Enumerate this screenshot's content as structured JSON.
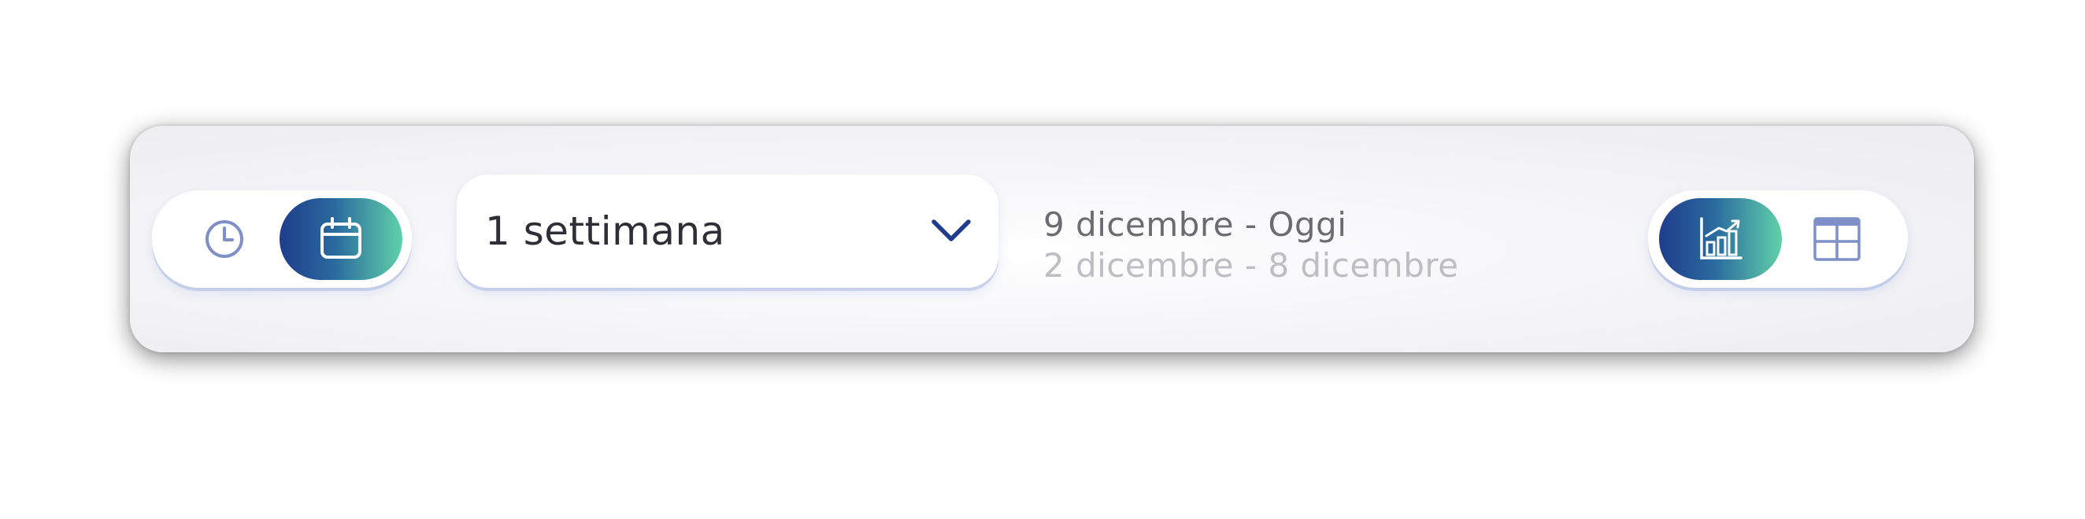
{
  "view_toggle": {
    "options": [
      {
        "icon": "clock-icon",
        "active": false
      },
      {
        "icon": "calendar-icon",
        "active": true
      }
    ]
  },
  "period_select": {
    "value": "1 settimana",
    "icon": "chevron-down-icon"
  },
  "date_range": {
    "current": "9 dicembre - Oggi",
    "previous": "2 dicembre - 8 dicembre"
  },
  "display_toggle": {
    "options": [
      {
        "icon": "chart-icon",
        "active": true
      },
      {
        "icon": "table-icon",
        "active": false
      }
    ]
  },
  "colors": {
    "accent_start": "#1f3d8c",
    "accent_end": "#5fd1a8",
    "icon_muted": "#7f8fc7",
    "chevron": "#1f3d8c"
  }
}
